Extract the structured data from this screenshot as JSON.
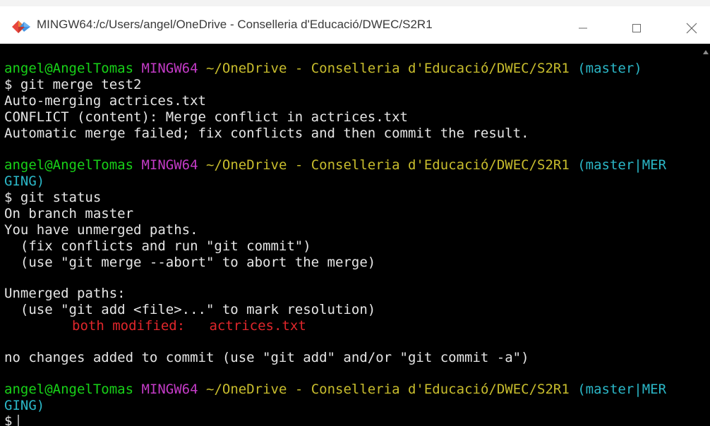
{
  "window": {
    "title": "MINGW64:/c/Users/angel/OneDrive - Conselleria d'Educació/DWEC/S2R1",
    "icon": "git-bash-diamond-icon"
  },
  "controls": {
    "minimize_icon": "minimize-icon",
    "maximize_icon": "maximize-icon",
    "close_icon": "close-icon"
  },
  "colors": {
    "background": "#000000",
    "text": "#e6e6e6",
    "user_host": "#18d218",
    "shell": "#c33bc6",
    "path": "#c8bd2d",
    "branch": "#2bb7c7",
    "conflict": "#e0262b"
  },
  "terminal": {
    "prompt1": {
      "user": "angel@AngelTomas",
      "shell": "MINGW64",
      "path": "~/OneDrive - Conselleria d'Educació/DWEC/S2R1",
      "branch": "(master)"
    },
    "cmd1": "$ git merge test2",
    "out1": [
      "Auto-merging actrices.txt",
      "CONFLICT (content): Merge conflict in actrices.txt",
      "Automatic merge failed; fix conflicts and then commit the result."
    ],
    "prompt2": {
      "user": "angel@AngelTomas",
      "shell": "MINGW64",
      "path": "~/OneDrive - Conselleria d'Educació/DWEC/S2R1",
      "branch_a": "(master|MER",
      "branch_b": "GING)"
    },
    "cmd2": "$ git status",
    "out2": [
      "On branch master",
      "You have unmerged paths.",
      "  (fix conflicts and run \"git commit\")",
      "  (use \"git merge --abort\" to abort the merge)"
    ],
    "unmerged_header": "Unmerged paths:",
    "unmerged_hint": "  (use \"git add <file>...\" to mark resolution)",
    "conflict_label": "both modified:",
    "conflict_file": "actrices.txt",
    "no_changes": "no changes added to commit (use \"git add\" and/or \"git commit -a\")",
    "prompt3": {
      "user": "angel@AngelTomas",
      "shell": "MINGW64",
      "path": "~/OneDrive - Conselleria d'Educació/DWEC/S2R1",
      "branch_a": "(master|MER",
      "branch_b": "GING)"
    },
    "cmd3": "$"
  }
}
